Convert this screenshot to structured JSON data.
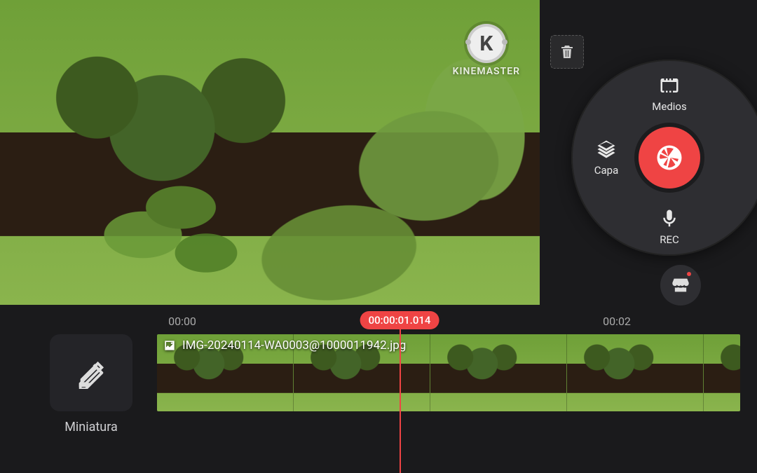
{
  "watermark": {
    "letter": "K",
    "brand": "KINEMASTER"
  },
  "wheel": {
    "media": "Medios",
    "layer": "Capa",
    "rec": "REC"
  },
  "timeline": {
    "tick_start": "00:00",
    "tick_end": "00:02",
    "playhead": "00:00:01.014",
    "clip_filename": "IMG-20240114-WA0003@1000011942.jpg"
  },
  "thumbnail": {
    "label": "Miniatura"
  }
}
